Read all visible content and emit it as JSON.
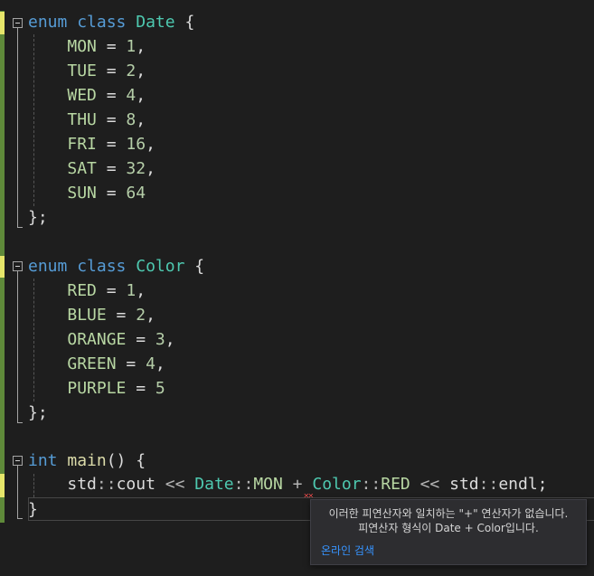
{
  "colors": {
    "background": "#1e1e1e",
    "keyword": "#569cd6",
    "type": "#4ec9b0",
    "enum_member": "#b8d7a3",
    "number": "#b5cea8",
    "function": "#dcdcaa",
    "saved_change_marker": "#5f8a3a",
    "unsaved_change_marker": "#e6e66a",
    "error_squiggle": "#f14c4c",
    "link": "#3794ff"
  },
  "code": {
    "enum_date": {
      "kw_enum": "enum",
      "kw_class": "class",
      "name": "Date",
      "open": "{",
      "members": [
        {
          "name": "MON",
          "eq": " = ",
          "value": "1",
          "sep": ","
        },
        {
          "name": "TUE",
          "eq": " = ",
          "value": "2",
          "sep": ","
        },
        {
          "name": "WED",
          "eq": " = ",
          "value": "4",
          "sep": ","
        },
        {
          "name": "THU",
          "eq": " = ",
          "value": "8",
          "sep": ","
        },
        {
          "name": "FRI",
          "eq": " = ",
          "value": "16",
          "sep": ","
        },
        {
          "name": "SAT",
          "eq": " = ",
          "value": "32",
          "sep": ","
        },
        {
          "name": "SUN",
          "eq": " = ",
          "value": "64",
          "sep": ""
        }
      ],
      "close": "};"
    },
    "enum_color": {
      "kw_enum": "enum",
      "kw_class": "class",
      "name": "Color",
      "open": "{",
      "members": [
        {
          "name": "RED",
          "eq": " = ",
          "value": "1",
          "sep": ","
        },
        {
          "name": "BLUE",
          "eq": " = ",
          "value": "2",
          "sep": ","
        },
        {
          "name": "ORANGE",
          "eq": " = ",
          "value": "3",
          "sep": ","
        },
        {
          "name": "GREEN",
          "eq": " = ",
          "value": "4",
          "sep": ","
        },
        {
          "name": "PURPLE",
          "eq": " = ",
          "value": "5",
          "sep": ""
        }
      ],
      "close": "};"
    },
    "main_fn": {
      "kw_int": "int",
      "name": "main",
      "parens": "()",
      "open": "{",
      "stmt": {
        "std1": "std",
        "scope": "::",
        "cout": "cout",
        "shift1": " << ",
        "type1": "Date",
        "member1": "MON",
        "plus": " + ",
        "type2": "Color",
        "member2": "RED",
        "shift2": " << ",
        "std2": "std",
        "endl": "endl",
        "semi": ";"
      },
      "close": "}"
    }
  },
  "tooltip": {
    "line1": "이러한 피연산자와 일치하는 \"+\" 연산자가 없습니다.",
    "line2": "피연산자 형식이 Date + Color입니다.",
    "link": "온라인 검색"
  }
}
